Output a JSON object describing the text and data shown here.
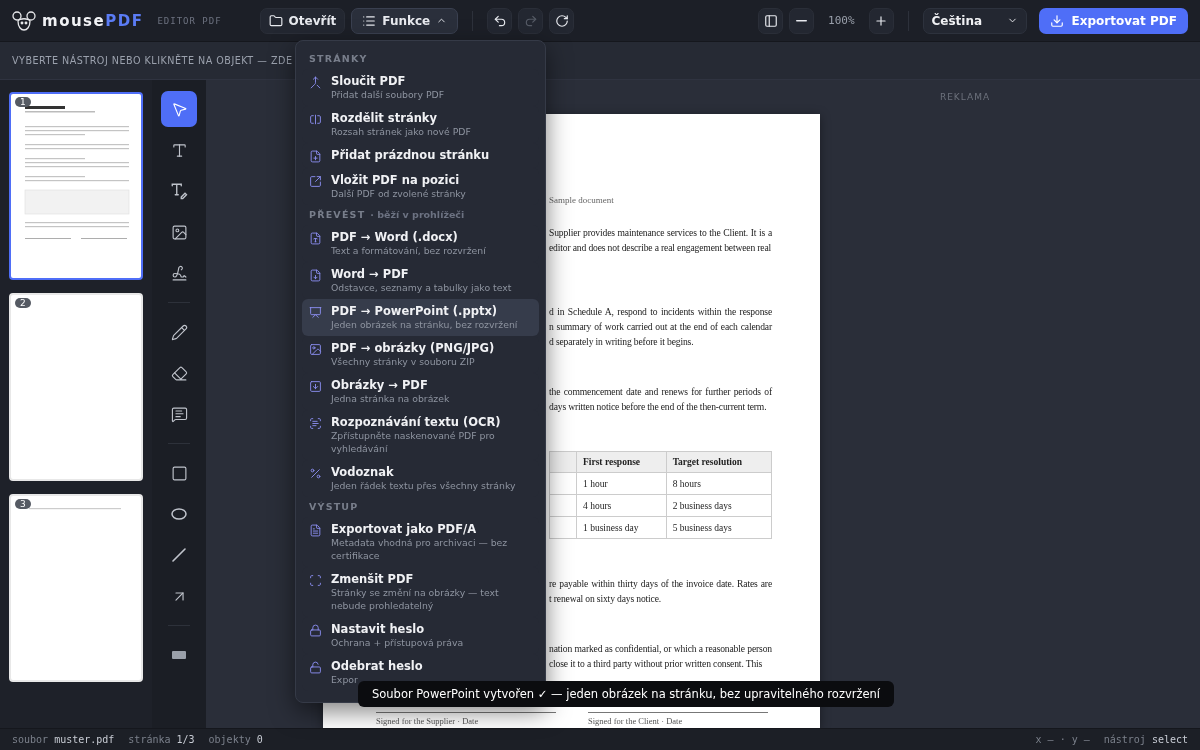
{
  "app": {
    "logo_main": "mouse",
    "logo_accent": "PDF",
    "subtitle": "EDITOR PDF"
  },
  "toolbar": {
    "open": "Otevřít",
    "functions": {
      "label": "Funkce",
      "expanded": true
    },
    "undo": {
      "disabled": false
    },
    "redo": {
      "disabled": true
    },
    "zoom": "100%",
    "language": "Čeština",
    "export": "Exportovat PDF"
  },
  "hint": "VYBERTE NÁSTROJ NEBO KLIKNĚTE NA OBJEKT — ZDE",
  "thumbnails": [
    {
      "number": "1",
      "selected": true,
      "kind": "text"
    },
    {
      "number": "2",
      "selected": false,
      "kind": "blank"
    },
    {
      "number": "3",
      "selected": false,
      "kind": "line"
    }
  ],
  "tool_groups": [
    [
      {
        "selected": true
      },
      {
        "selected": false
      },
      {
        "selected": false
      },
      {
        "selected": false
      },
      {
        "selected": false
      }
    ],
    [
      {
        "selected": false
      },
      {
        "selected": false
      },
      {
        "selected": false
      }
    ],
    [
      {
        "selected": false
      },
      {
        "selected": false
      },
      {
        "selected": false
      },
      {
        "selected": false
      }
    ],
    [
      {
        "selected": false
      }
    ]
  ],
  "menu": {
    "sections": [
      {
        "title": "STRÁNKY",
        "items": [
          {
            "title": "Sloučit PDF",
            "description": "Přidat další soubory PDF",
            "highlighted": false
          },
          {
            "title": "Rozdělit stránky",
            "description": "Rozsah stránek jako nové PDF",
            "highlighted": false
          },
          {
            "title": "Přidat prázdnou stránku",
            "highlighted": false
          },
          {
            "title": "Vložit PDF na pozici",
            "description": "Další PDF od zvolené stránky",
            "highlighted": false
          }
        ]
      },
      {
        "title": "PŘEVÉST",
        "note": "· běží v prohlížeči",
        "items": [
          {
            "title": "PDF → Word (.docx)",
            "description": "Text a formátování, bez rozvržení",
            "highlighted": false
          },
          {
            "title": "Word → PDF",
            "description": "Odstavce, seznamy a tabulky jako text",
            "highlighted": false
          },
          {
            "title": "PDF → PowerPoint (.pptx)",
            "description": "Jeden obrázek na stránku, bez rozvržení",
            "highlighted": true
          },
          {
            "title": "PDF → obrázky (PNG/JPG)",
            "description": "Všechny stránky v souboru ZIP",
            "highlighted": false
          },
          {
            "title": "Obrázky → PDF",
            "description": "Jedna stránka na obrázek",
            "highlighted": false
          },
          {
            "title": "Rozpoznávání textu (OCR)",
            "description": "Zpřístupněte naskenované PDF pro vyhledávání",
            "highlighted": false
          },
          {
            "title": "Vodoznak",
            "description": "Jeden řádek textu přes všechny stránky",
            "highlighted": false
          }
        ]
      },
      {
        "title": "VÝSTUP",
        "items": [
          {
            "title": "Exportovat jako PDF/A",
            "description": "Metadata vhodná pro archivaci — bez certifikace",
            "highlighted": false
          },
          {
            "title": "Zmenšit PDF",
            "description": "Stránky se změní na obrázky — text nebude prohledatelný",
            "highlighted": false
          },
          {
            "title": "Nastavit heslo",
            "description": "Ochrana + přístupová práva",
            "highlighted": false
          },
          {
            "title": "Odebrat heslo",
            "description": "Expor",
            "highlighted": false
          }
        ]
      }
    ]
  },
  "ad_label": "REKLAMA",
  "document": {
    "subtitle": "Sample document",
    "blocks": [
      {
        "kind": "paragraph",
        "lines": [
          "Supplier provides maintenance services to the Client. It is a",
          "editor and does not describe a real engagement between real"
        ]
      },
      {
        "kind": "paragraph",
        "lines": [
          "d in Schedule A, respond to incidents within the response",
          "n summary of work carried out at the end of each calendar",
          "d separately in writing before it begins."
        ]
      },
      {
        "kind": "paragraph",
        "lines": [
          "the commencement date and renews for further periods of",
          "days written notice before the end of the then-current term."
        ]
      },
      {
        "kind": "table",
        "columns": [
          "First response",
          "Target resolution"
        ],
        "rows": [
          [
            "1 hour",
            "8 hours"
          ],
          [
            "4 hours",
            "2 business days"
          ],
          [
            "1 business day",
            "5 business days"
          ]
        ]
      },
      {
        "kind": "paragraph",
        "lines": [
          "re payable within thirty days of the invoice date. Rates are",
          "t renewal on sixty days notice."
        ]
      },
      {
        "kind": "paragraph",
        "lines": [
          "nation marked as confidential, or which a reasonable person",
          "close it to a third party without prior written consent. This"
        ]
      }
    ],
    "signatures": [
      "Signed for the Supplier · Date",
      "Signed for the Client · Date"
    ]
  },
  "toast": "Soubor PowerPoint vytvořen ✓ — jeden obrázek na stránku, bez upravitelného rozvržení",
  "status": {
    "file_label": "soubor",
    "file": "muster.pdf",
    "page_label": "stránka",
    "page": "1/3",
    "objects_label": "objekty",
    "objects": "0",
    "x": "x –",
    "dot": "·",
    "y": "y –",
    "tool_label": "nástroj",
    "tool": "select"
  }
}
